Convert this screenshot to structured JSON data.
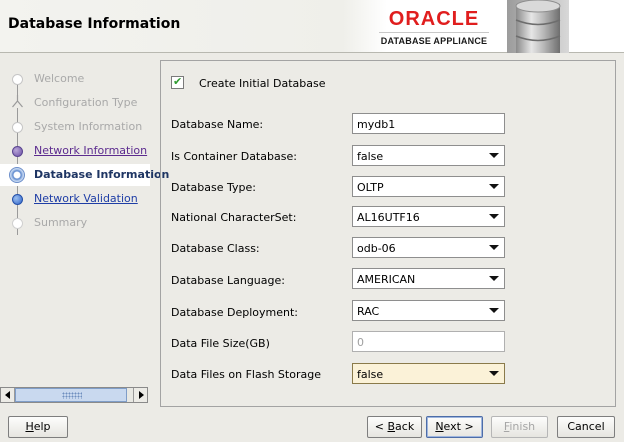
{
  "header": {
    "title": "Database Information",
    "logo": {
      "brand": "ORACLE",
      "product": "DATABASE APPLIANCE"
    }
  },
  "nav": {
    "items": [
      {
        "label": "Welcome",
        "state": "done"
      },
      {
        "label": "Configuration Type",
        "state": "done"
      },
      {
        "label": "System Information",
        "state": "done"
      },
      {
        "label": "Network Information",
        "state": "visited"
      },
      {
        "label": "Database Information",
        "state": "current"
      },
      {
        "label": "Network Validation",
        "state": "next"
      },
      {
        "label": "Summary",
        "state": "pending"
      }
    ]
  },
  "form": {
    "create_initial_database": {
      "label": "Create Initial Database",
      "checked": true
    },
    "fields": [
      {
        "label": "Database Name:",
        "value": "mydb1",
        "type": "text"
      },
      {
        "label": "Is Container Database:",
        "value": "false",
        "type": "select"
      },
      {
        "label": "Database Type:",
        "value": "OLTP",
        "type": "select"
      },
      {
        "label": "National CharacterSet:",
        "value": "AL16UTF16",
        "type": "select"
      },
      {
        "label": "Database Class:",
        "value": "odb-06",
        "type": "select"
      },
      {
        "label": "Database Language:",
        "value": "AMERICAN",
        "type": "select"
      },
      {
        "label": "Database Deployment:",
        "value": "RAC",
        "type": "select"
      },
      {
        "label": "Data File Size(GB)",
        "value": "0",
        "type": "text",
        "disabled": true
      },
      {
        "label": "Data Files on Flash Storage",
        "value": "false",
        "type": "select",
        "focused": true
      }
    ]
  },
  "buttons": {
    "help": {
      "mnemonic": "H",
      "rest": "elp"
    },
    "back": {
      "prefix": "< ",
      "mnemonic": "B",
      "rest": "ack"
    },
    "next": {
      "mnemonic": "N",
      "rest": "ext >"
    },
    "finish": {
      "mnemonic": "F",
      "rest": "inish"
    },
    "cancel": {
      "label": "Cancel"
    }
  },
  "colors": {
    "brand_red": "#e01e1e",
    "visited_link": "#5c2b8f",
    "link": "#1f3ea6",
    "current_step": "#1e3563",
    "focused_field": "#fbf2d8"
  }
}
